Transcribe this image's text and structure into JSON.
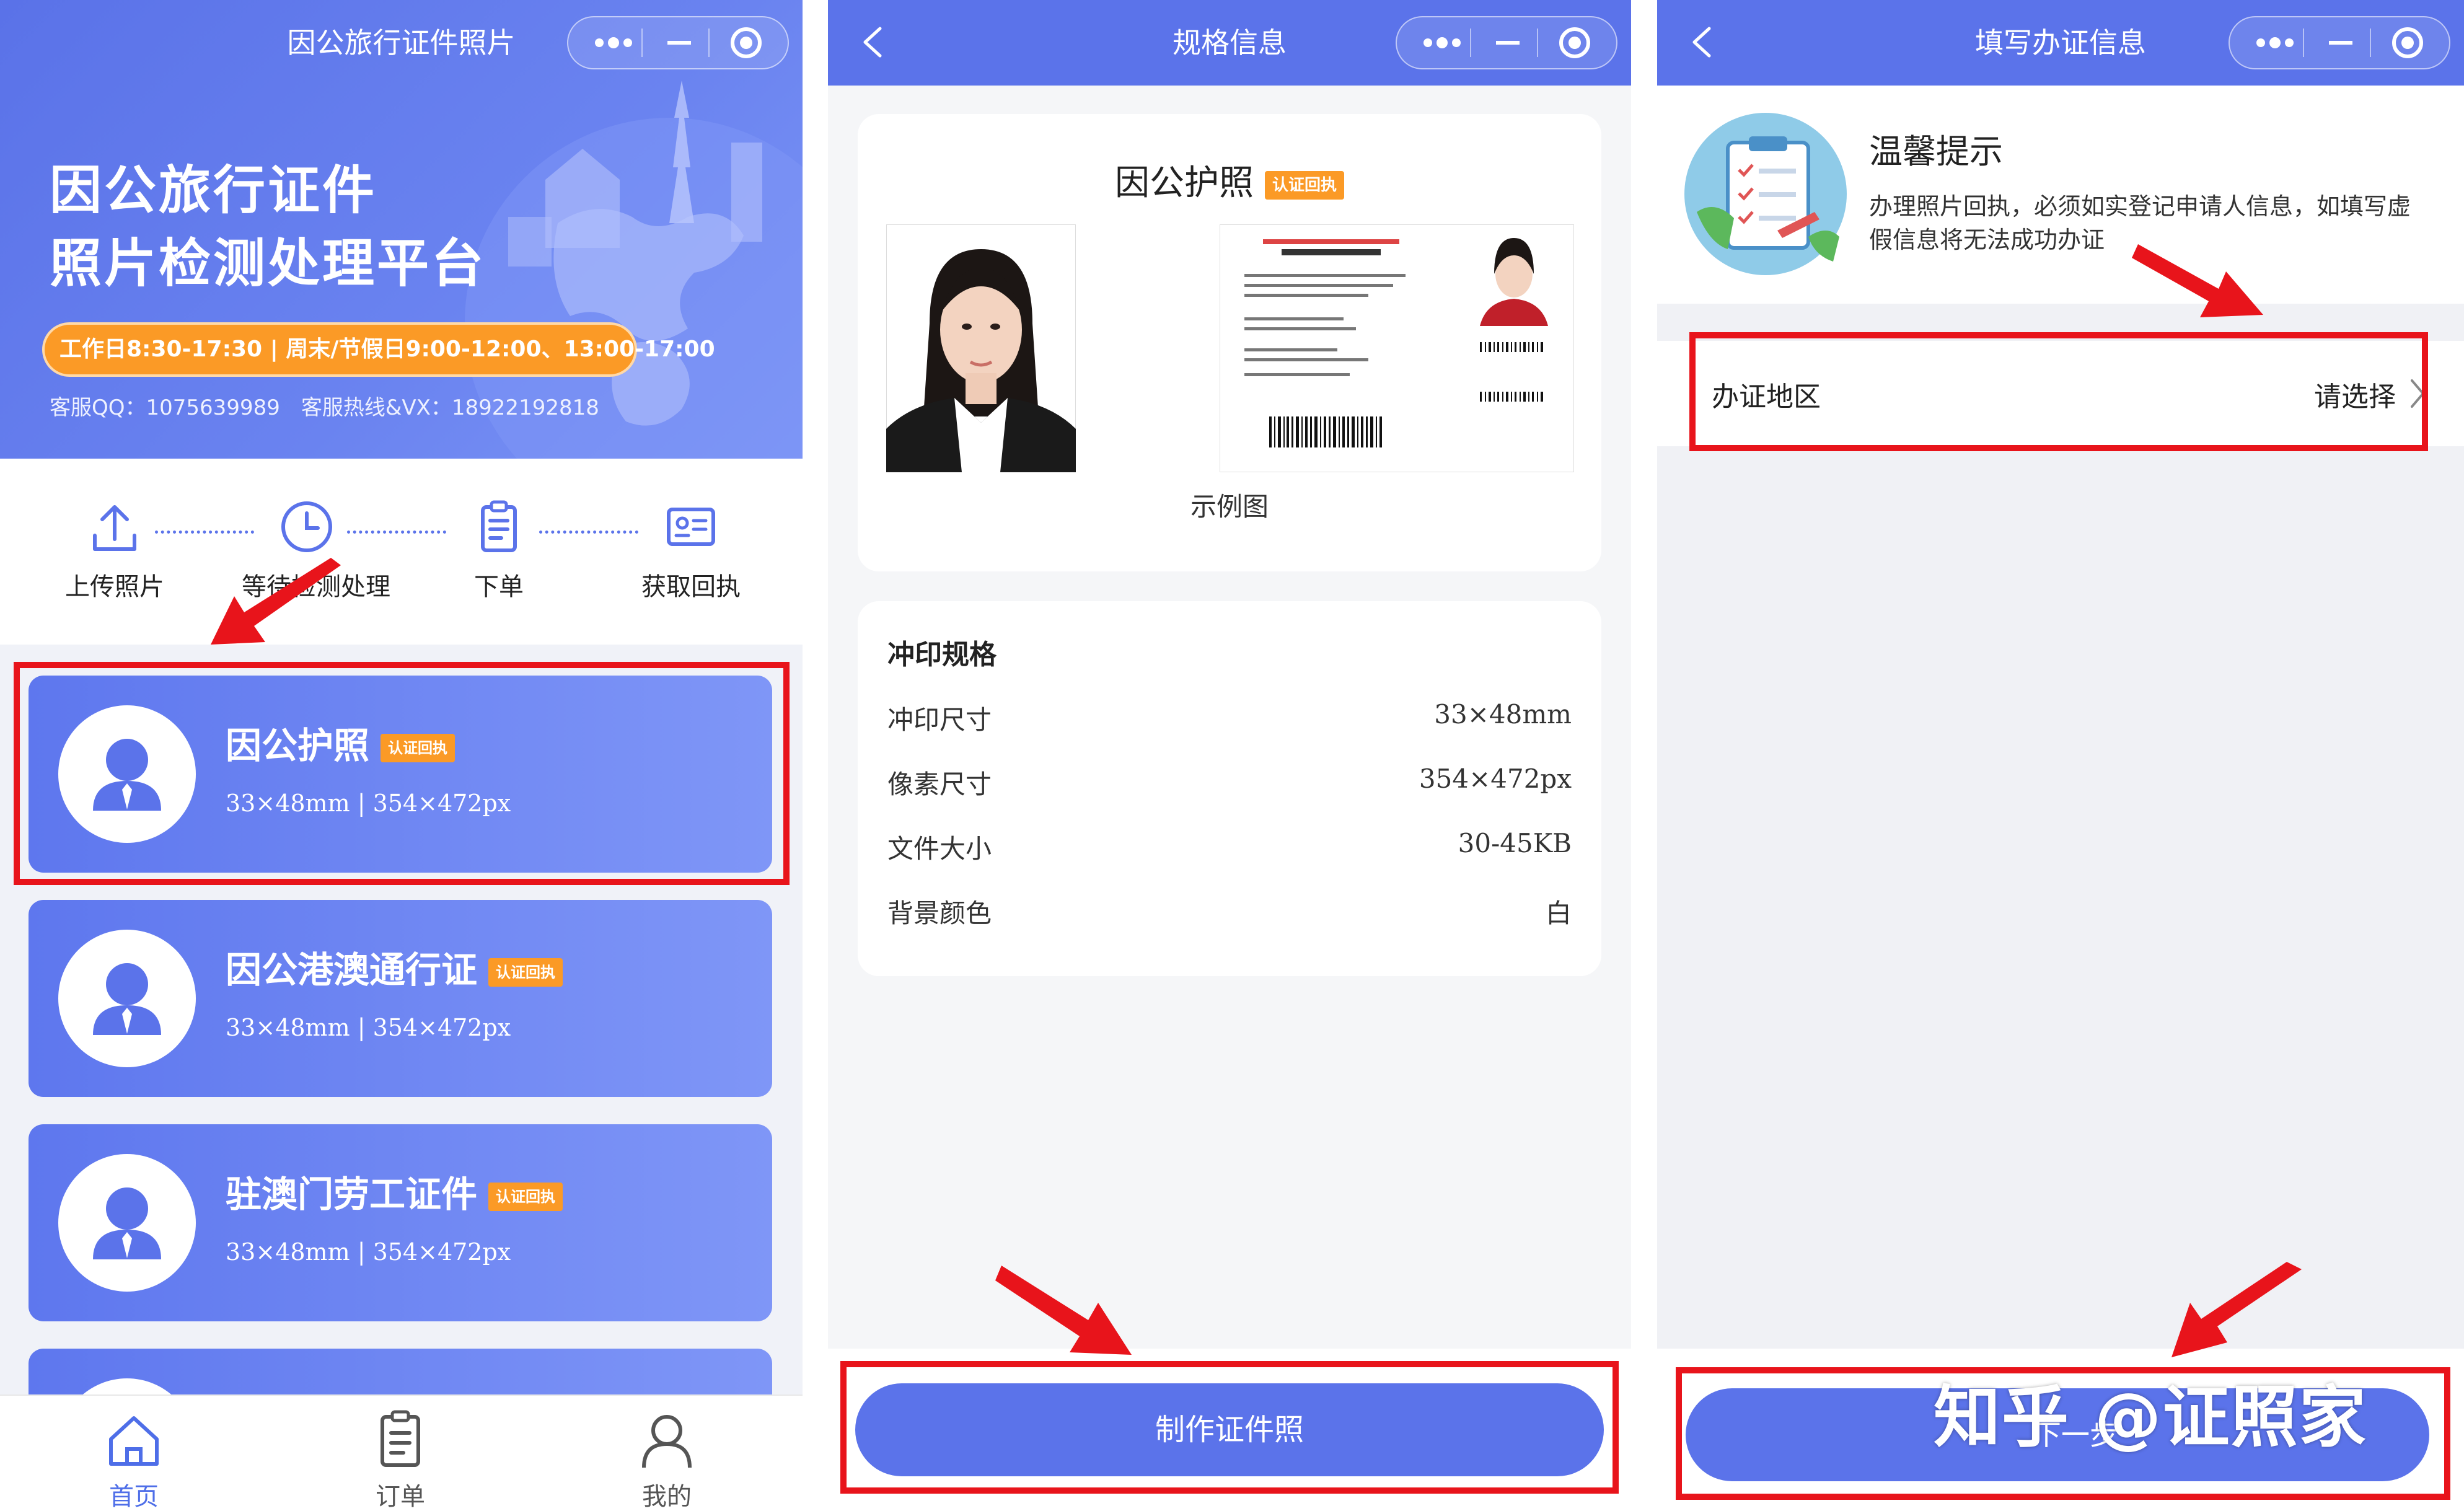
{
  "colors": {
    "brand": "#5b73ea",
    "badge": "#fb9a26",
    "annotation": "#e8141b"
  },
  "panel1": {
    "nav_title": "因公旅行证件照片",
    "hero": {
      "title_line1": "因公旅行证件",
      "title_line2": "照片检测处理平台",
      "hours": "工作日8:30-17:30 | 周末/节假日9:00-12:00、13:00-17:00",
      "contact": "客服QQ：1075639989　客服热线&VX：18922192818"
    },
    "steps": [
      {
        "label": "上传照片",
        "icon": "upload-icon"
      },
      {
        "label": "等待检测处理",
        "icon": "clock-icon"
      },
      {
        "label": "下单",
        "icon": "order-clipboard-icon"
      },
      {
        "label": "获取回执",
        "icon": "receipt-card-icon"
      }
    ],
    "cards": [
      {
        "name": "因公护照",
        "badge": "认证回执",
        "spec": "33×48mm | 354×472px"
      },
      {
        "name": "因公港澳通行证",
        "badge": "认证回执",
        "spec": "33×48mm | 354×472px"
      },
      {
        "name": "驻澳门劳工证件",
        "badge": "认证回执",
        "spec": "33×48mm | 354×472px"
      }
    ],
    "tabbar": [
      {
        "label": "首页",
        "icon": "home-icon",
        "active": true
      },
      {
        "label": "订单",
        "icon": "order-list-icon",
        "active": false
      },
      {
        "label": "我的",
        "icon": "profile-icon",
        "active": false
      }
    ]
  },
  "panel2": {
    "nav_title": "规格信息",
    "title": "因公护照",
    "badge": "认证回执",
    "sample_caption": "示例图",
    "section_title": "冲印规格",
    "rows": [
      {
        "k": "冲印尺寸",
        "v": "33×48mm"
      },
      {
        "k": "像素尺寸",
        "v": "354×472px"
      },
      {
        "k": "文件大小",
        "v": "30-45KB"
      },
      {
        "k": "背景颜色",
        "v": "白"
      }
    ],
    "button": "制作证件照"
  },
  "panel3": {
    "nav_title": "填写办证信息",
    "tips_title": "温馨提示",
    "tips_body": "办理照片回执，必须如实登记申请人信息，如填写虚假信息将无法成功办证",
    "region_label": "办证地区",
    "region_value": "请选择",
    "button": "下一步"
  },
  "watermark": "知乎 @证照家"
}
